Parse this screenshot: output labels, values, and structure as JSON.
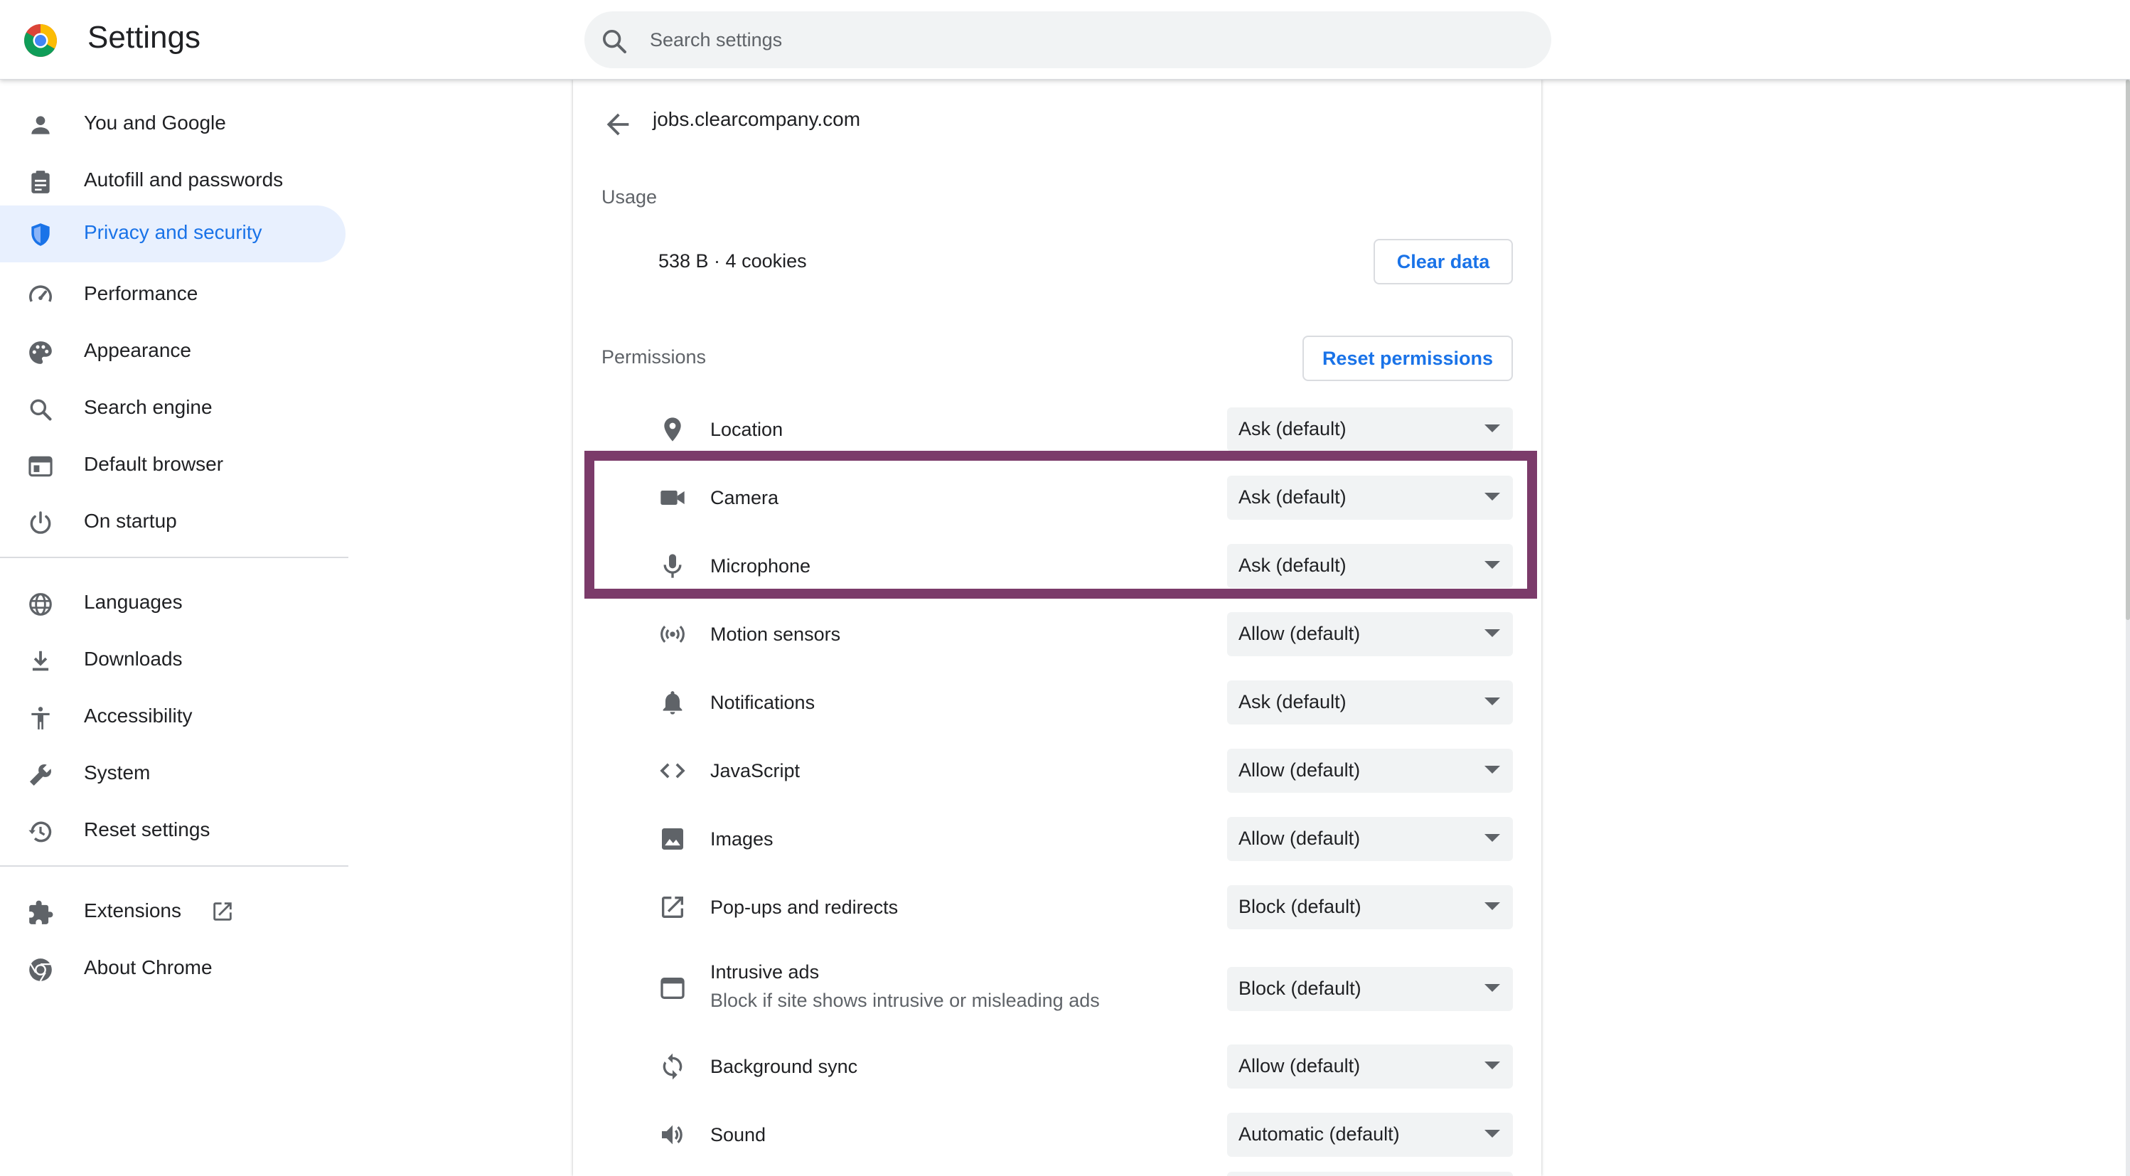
{
  "header": {
    "title": "Settings",
    "search_placeholder": "Search settings"
  },
  "sidebar": {
    "items": [
      {
        "label": "You and Google",
        "icon": "person-icon"
      },
      {
        "label": "Autofill and passwords",
        "icon": "clipboard-icon"
      },
      {
        "label": "Privacy and security",
        "icon": "shield-icon",
        "active": true
      },
      {
        "label": "Performance",
        "icon": "speedometer-icon"
      },
      {
        "label": "Appearance",
        "icon": "palette-icon"
      },
      {
        "label": "Search engine",
        "icon": "search-icon"
      },
      {
        "label": "Default browser",
        "icon": "browser-window-icon"
      },
      {
        "label": "On startup",
        "icon": "power-icon"
      },
      {
        "label": "Languages",
        "icon": "globe-icon"
      },
      {
        "label": "Downloads",
        "icon": "download-icon"
      },
      {
        "label": "Accessibility",
        "icon": "accessibility-icon"
      },
      {
        "label": "System",
        "icon": "wrench-icon"
      },
      {
        "label": "Reset settings",
        "icon": "history-icon"
      },
      {
        "label": "Extensions",
        "icon": "puzzle-icon"
      },
      {
        "label": "About Chrome",
        "icon": "chrome-icon"
      }
    ]
  },
  "site": {
    "title": "jobs.clearcompany.com",
    "usage_label": "Usage",
    "usage_value": "538 B · 4 cookies",
    "clear_data_label": "Clear data",
    "permissions_label": "Permissions",
    "reset_permissions_label": "Reset permissions"
  },
  "permissions": [
    {
      "label": "Location",
      "value": "Ask (default)",
      "icon": "location-pin-icon"
    },
    {
      "label": "Camera",
      "value": "Ask (default)",
      "icon": "camera-icon"
    },
    {
      "label": "Microphone",
      "value": "Ask (default)",
      "icon": "microphone-icon"
    },
    {
      "label": "Motion sensors",
      "value": "Allow (default)",
      "icon": "motion-sensors-icon"
    },
    {
      "label": "Notifications",
      "value": "Ask (default)",
      "icon": "bell-icon"
    },
    {
      "label": "JavaScript",
      "value": "Allow (default)",
      "icon": "code-icon"
    },
    {
      "label": "Images",
      "value": "Allow (default)",
      "icon": "image-icon"
    },
    {
      "label": "Pop-ups and redirects",
      "value": "Block (default)",
      "icon": "open-in-new-icon"
    },
    {
      "label": "Intrusive ads",
      "sublabel": "Block if site shows intrusive or misleading ads",
      "value": "Block (default)",
      "icon": "ad-window-icon"
    },
    {
      "label": "Background sync",
      "value": "Allow (default)",
      "icon": "sync-icon"
    },
    {
      "label": "Sound",
      "value": "Automatic (default)",
      "icon": "speaker-icon"
    }
  ],
  "colors": {
    "accent": "#1a73e8",
    "active_bg": "#e8f0fe",
    "highlight": "#7b3b6a"
  }
}
